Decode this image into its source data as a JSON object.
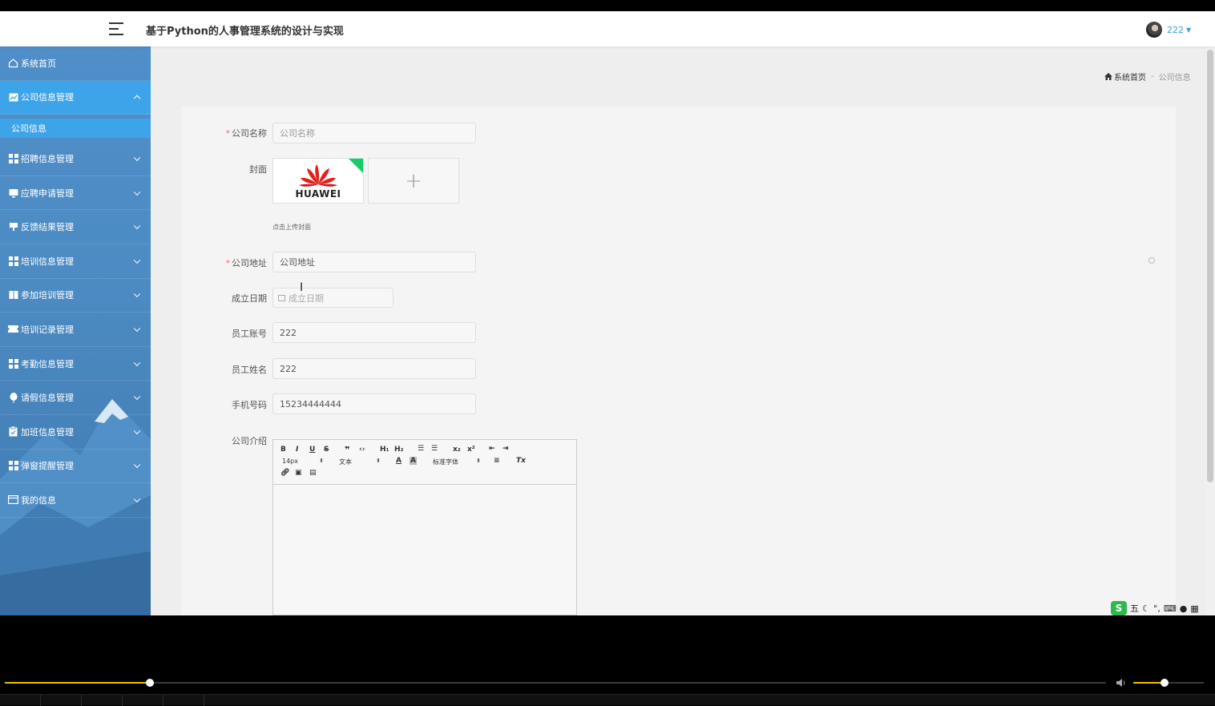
{
  "app": {
    "title": "基于Python的人事管理系统的设计与实现"
  },
  "user": {
    "name": "222"
  },
  "sidebar": {
    "items": [
      {
        "label": "系统首页",
        "icon": "home-icon",
        "open": false
      },
      {
        "label": "公司信息管理",
        "icon": "chart-icon",
        "open": true,
        "children": [
          {
            "label": "公司信息",
            "active": true
          }
        ]
      },
      {
        "label": "招聘信息管理",
        "icon": "grid-icon",
        "open": false
      },
      {
        "label": "应聘申请管理",
        "icon": "monitor-icon",
        "open": false
      },
      {
        "label": "反馈结果管理",
        "icon": "thumb-icon",
        "open": false
      },
      {
        "label": "培训信息管理",
        "icon": "grid-icon",
        "open": false
      },
      {
        "label": "参加培训管理",
        "icon": "book-icon",
        "open": false
      },
      {
        "label": "培训记录管理",
        "icon": "ticket-icon",
        "open": false
      },
      {
        "label": "考勤信息管理",
        "icon": "grid-icon",
        "open": false
      },
      {
        "label": "请假信息管理",
        "icon": "balloon-icon",
        "open": false
      },
      {
        "label": "加班信息管理",
        "icon": "clipboard-icon",
        "open": false
      },
      {
        "label": "弹窗提醒管理",
        "icon": "grid-icon",
        "open": false
      },
      {
        "label": "我的信息",
        "icon": "card-icon",
        "open": false
      }
    ]
  },
  "breadcrumb": {
    "home": "系统首页",
    "separator": "-",
    "current": "公司信息"
  },
  "form": {
    "company_name": {
      "label": "公司名称",
      "required": true,
      "placeholder": "公司名称",
      "value": ""
    },
    "cover": {
      "label": "封面",
      "hint": "点击上传封面",
      "logo_text": "HUAWEI",
      "add_symbol": "+"
    },
    "address": {
      "label": "公司地址",
      "required": true,
      "value": "公司地址"
    },
    "founded": {
      "label": "成立日期",
      "placeholder": "成立日期"
    },
    "employee_account": {
      "label": "员工账号",
      "value": "222"
    },
    "employee_name": {
      "label": "员工姓名",
      "value": "222"
    },
    "phone": {
      "label": "手机号码",
      "value": "15234444444"
    },
    "intro": {
      "label": "公司介绍",
      "toolbar": {
        "font_size": "14px",
        "text_type": "文本",
        "font_family": "标准字体",
        "h1": "H₁",
        "h2": "H₂",
        "sub": "x₂",
        "sup": "x²"
      }
    }
  },
  "ime": {
    "logo": "S",
    "mode": "五"
  },
  "player": {
    "progress": 0.132,
    "volume": 0.44
  },
  "colors": {
    "sidebar": "#4c8bc3",
    "active": "#3da4ea",
    "required": "#f56c6c",
    "accent": "#3a9fd8",
    "player_progress": "#e6c200"
  }
}
